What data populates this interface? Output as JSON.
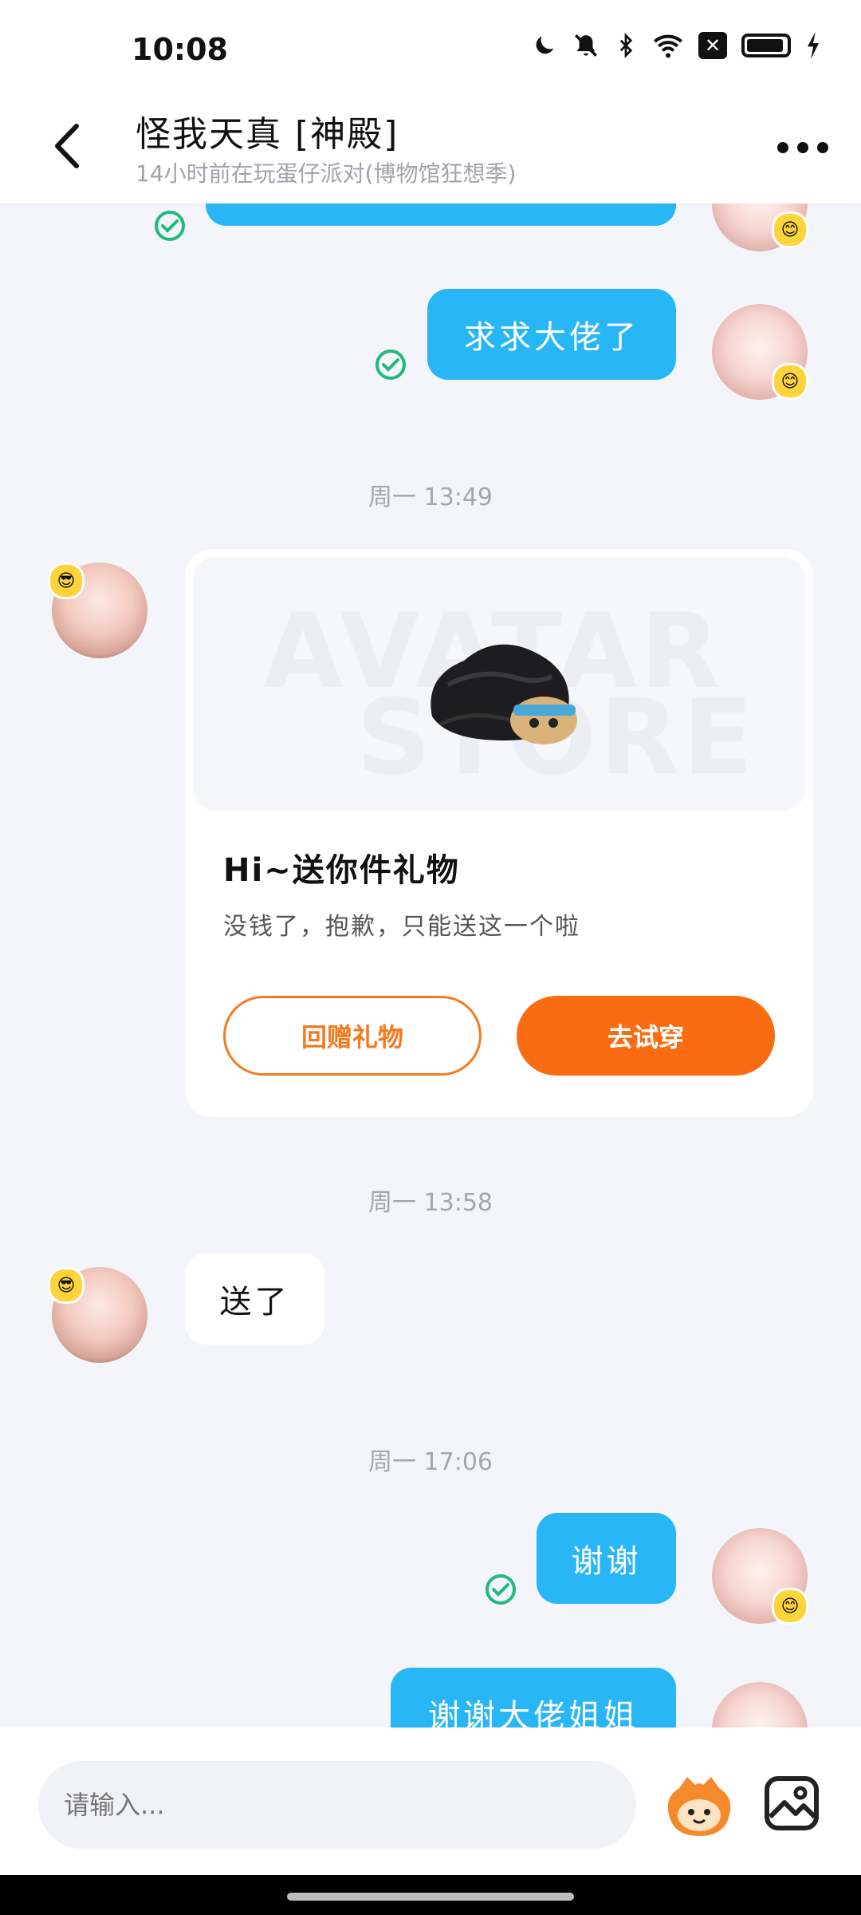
{
  "status_bar": {
    "time": "10:08",
    "icons": [
      "moon-icon",
      "bell-off-icon",
      "bluetooth-icon",
      "wifi-icon",
      "x-box-icon",
      "battery-icon",
      "charging-icon"
    ]
  },
  "header": {
    "title": "怪我天真  [神殿]",
    "subtitle": "14小时前在玩蛋仔派对(博物馆狂想季)"
  },
  "messages": {
    "m1": {
      "text": "求求大佬了"
    },
    "ts1": "周一 13:49",
    "gift_card": {
      "watermark_line1": "AVATAR",
      "watermark_line2": "STORE",
      "title": "Hi~送你件礼物",
      "description": "没钱了，抱歉，只能送这一个啦",
      "return_gift_label": "回赠礼物",
      "try_on_label": "去试穿"
    },
    "ts2": "周一 13:58",
    "m2": {
      "text": "送了"
    },
    "ts3": "周一 17:06",
    "m3": {
      "text": "谢谢"
    },
    "m4": {
      "text": "谢谢大佬姐姐"
    }
  },
  "input": {
    "placeholder": "请输入..."
  },
  "colors": {
    "outgoing_bubble": "#28b6f6",
    "accent_orange": "#f96c12",
    "sent_check": "#1fb97d",
    "background": "#f3f5fa"
  }
}
